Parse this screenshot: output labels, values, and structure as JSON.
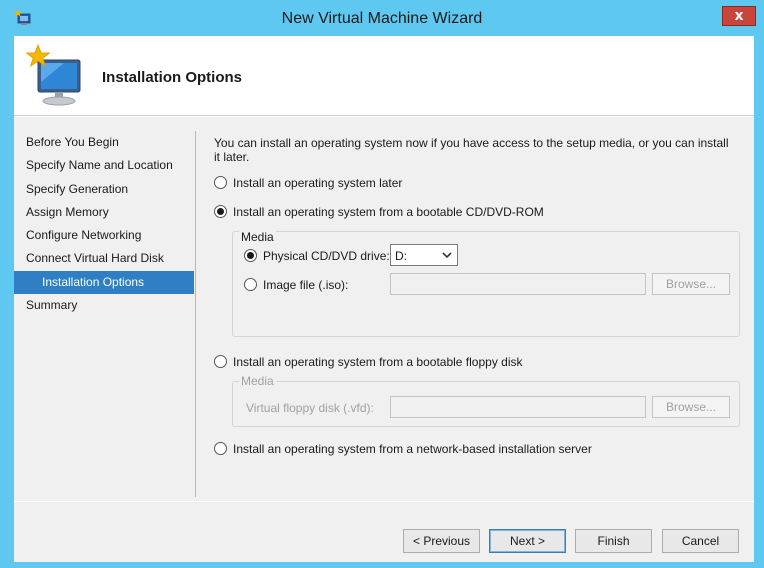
{
  "window": {
    "title": "New Virtual Machine Wizard",
    "close_label": "x"
  },
  "header": {
    "title": "Installation Options"
  },
  "nav": {
    "items": [
      {
        "label": "Before You Begin"
      },
      {
        "label": "Specify Name and Location"
      },
      {
        "label": "Specify Generation"
      },
      {
        "label": "Assign Memory"
      },
      {
        "label": "Configure Networking"
      },
      {
        "label": "Connect Virtual Hard Disk"
      },
      {
        "label": "Installation Options"
      },
      {
        "label": "Summary"
      }
    ],
    "selected_index": 6
  },
  "content": {
    "intro": "You can install an operating system now if you have access to the setup media, or you can install it later.",
    "options": [
      {
        "label": "Install an operating system later",
        "checked": false
      },
      {
        "label": "Install an operating system from a bootable CD/DVD-ROM",
        "checked": true
      },
      {
        "label": "Install an operating system from a bootable floppy disk",
        "checked": false
      },
      {
        "label": "Install an operating system from a network-based installation server",
        "checked": false
      }
    ],
    "cd_media": {
      "group_title": "Media",
      "physical_label": "Physical CD/DVD drive:",
      "physical_checked": true,
      "drive_value": "D:",
      "image_label": "Image file (.iso):",
      "image_checked": false,
      "image_value": "",
      "browse_label": "Browse..."
    },
    "floppy_media": {
      "group_title": "Media",
      "vfd_label": "Virtual floppy disk (.vfd):",
      "vfd_value": "",
      "browse_label": "Browse..."
    }
  },
  "footer": {
    "previous_label": "< Previous",
    "next_label": "Next >",
    "finish_label": "Finish",
    "cancel_label": "Cancel"
  },
  "colors": {
    "titlebar": "#5ec8f0",
    "selection": "#2e7fc4",
    "panel": "#f0f0f0"
  }
}
